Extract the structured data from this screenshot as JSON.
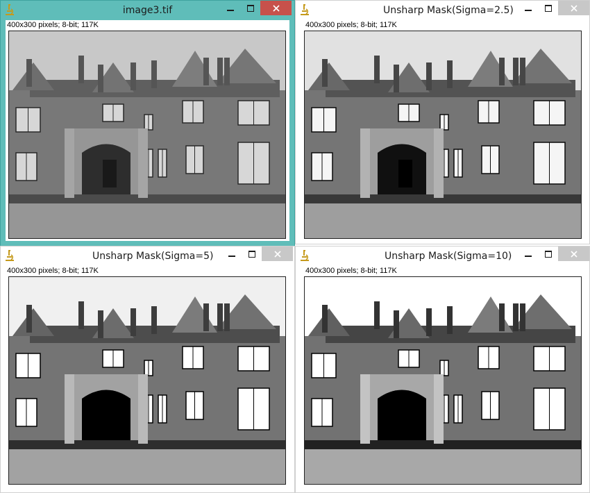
{
  "windows": [
    {
      "title": "image3.tif",
      "info": "400x300 pixels; 8-bit; 117K",
      "active": true,
      "image_icon": "house-photo-icon"
    },
    {
      "title": "Unsharp Mask(Sigma=2.5)",
      "info": "400x300 pixels; 8-bit; 117K",
      "active": false,
      "image_icon": "house-photo-icon"
    },
    {
      "title": "Unsharp Mask(Sigma=5)",
      "info": "400x300 pixels; 8-bit; 117K",
      "active": false,
      "image_icon": "house-photo-icon"
    },
    {
      "title": "Unsharp Mask(Sigma=10)",
      "info": "400x300 pixels; 8-bit; 117K",
      "active": false,
      "image_icon": "house-photo-icon"
    }
  ],
  "icons": {
    "app": "microscope-icon",
    "minimize": "minimize-icon",
    "maximize": "maximize-icon",
    "close": "close-icon"
  },
  "colors": {
    "active_frame": "#5fbdb9",
    "close_active": "#c7514b",
    "close_inactive": "#c8c8c8"
  }
}
